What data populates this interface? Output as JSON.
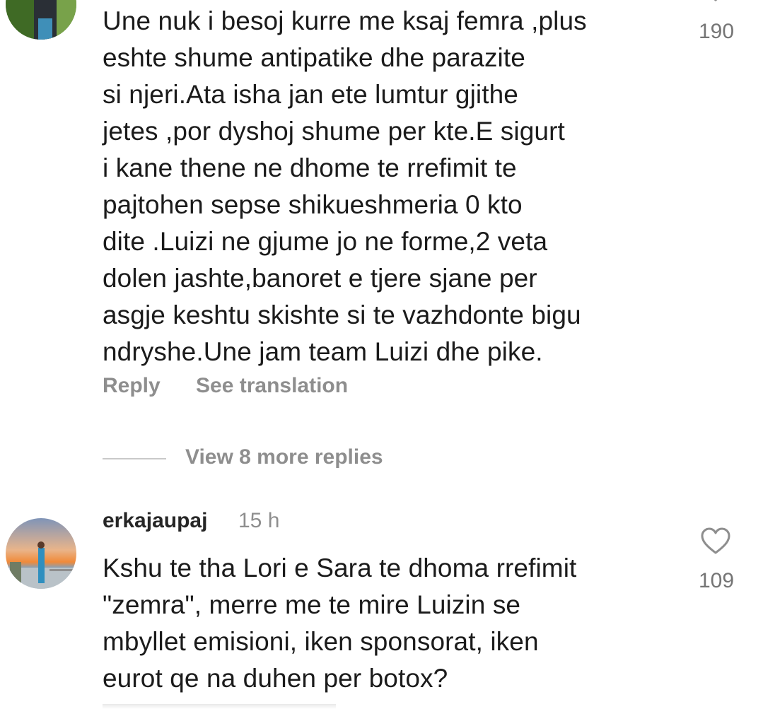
{
  "comments": [
    {
      "text": "Une nuk i besoj kurre me ksaj femra ,plus\neshte shume antipatike dhe parazite\nsi njeri.Ata isha jan ete lumtur gjithe\njetes ,por dyshoj shume per kte.E sigurt\ni kane thene ne dhome te rrefimit te\npajtohen sepse shikueshmeria 0 kto\ndite .Luizi ne gjume jo ne forme,2 veta\ndolen jashte,banoret e tjere sjane per\nasgje keshtu skishte si te vazhdonte bigu\nndryshe.Une jam team Luizi dhe pike.",
      "likes": "190",
      "reply_label": "Reply",
      "translate_label": "See translation",
      "view_replies_label": "View 8 more replies"
    },
    {
      "username": "erkajaupaj",
      "time": "15 h",
      "text": "Kshu te tha Lori e Sara te dhoma rrefimit\n\"zemra\", merre me te mire Luizin se\nmbyllet emisioni, iken sponsorat, iken\neurot qe na duhen per botox?",
      "likes": "109"
    }
  ],
  "icons": {
    "like": "heart-outline-icon"
  },
  "colors": {
    "text": "#1b1b1b",
    "muted": "#8e8e8e",
    "like_count": "#757575"
  }
}
